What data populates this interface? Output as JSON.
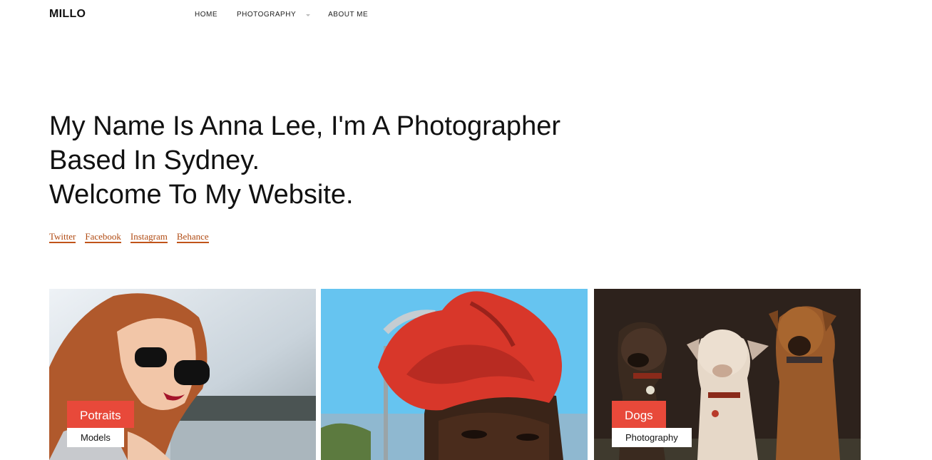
{
  "header": {
    "logo": "MILLO",
    "nav": [
      {
        "label": "HOME"
      },
      {
        "label": "PHOTOGRAPHY",
        "has_dropdown": true
      },
      {
        "label": "ABOUT ME"
      }
    ]
  },
  "hero": {
    "line1": "My Name Is Anna Lee, I'm A Photographer",
    "line2": "Based In Sydney.",
    "line3": "Welcome To My Website."
  },
  "social": [
    "Twitter",
    "Facebook",
    "Instagram",
    "Behance"
  ],
  "gallery": [
    {
      "title": "Potraits",
      "category": "Models",
      "image": "woman with sunglasses"
    },
    {
      "title": "",
      "category": "",
      "image": "woman with red headwrap"
    },
    {
      "title": "Dogs",
      "category": "Photography",
      "image": "three dogs"
    }
  ],
  "colors": {
    "accent_tag": "#e8493a",
    "link": "#b04a12",
    "text": "#111111",
    "background": "#ffffff"
  }
}
